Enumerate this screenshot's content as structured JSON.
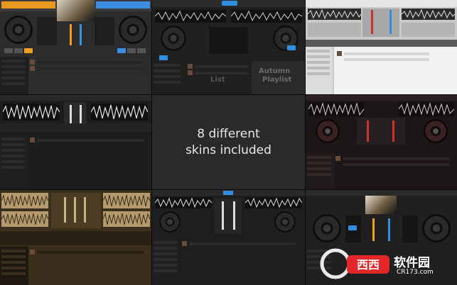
{
  "caption": {
    "line1": "8 different",
    "line2": "skins included"
  },
  "overlay_labels": {
    "autumn_title": "Autumn",
    "autumn_sub": "Playlist",
    "list_label": "List"
  },
  "watermark": {
    "brand_cn": "软件园",
    "brand_url": "CR173.com",
    "logo_letters": "西西"
  },
  "skins": [
    {
      "name": "skin-ipad-dark-orange"
    },
    {
      "name": "skin-dark-blue-mixer"
    },
    {
      "name": "skin-light-grey"
    },
    {
      "name": "skin-dark-waveform"
    },
    {
      "name": "skin-dark-red"
    },
    {
      "name": "skin-brown-vintage"
    },
    {
      "name": "skin-dark-blue-compact"
    },
    {
      "name": "skin-dark-blue-video"
    }
  ],
  "colors": {
    "accent_orange": "#f0a020",
    "accent_blue": "#2f8fe0",
    "accent_red": "#d03030",
    "waveform_white": "#e6e6e6",
    "brown": "#6b5431"
  }
}
